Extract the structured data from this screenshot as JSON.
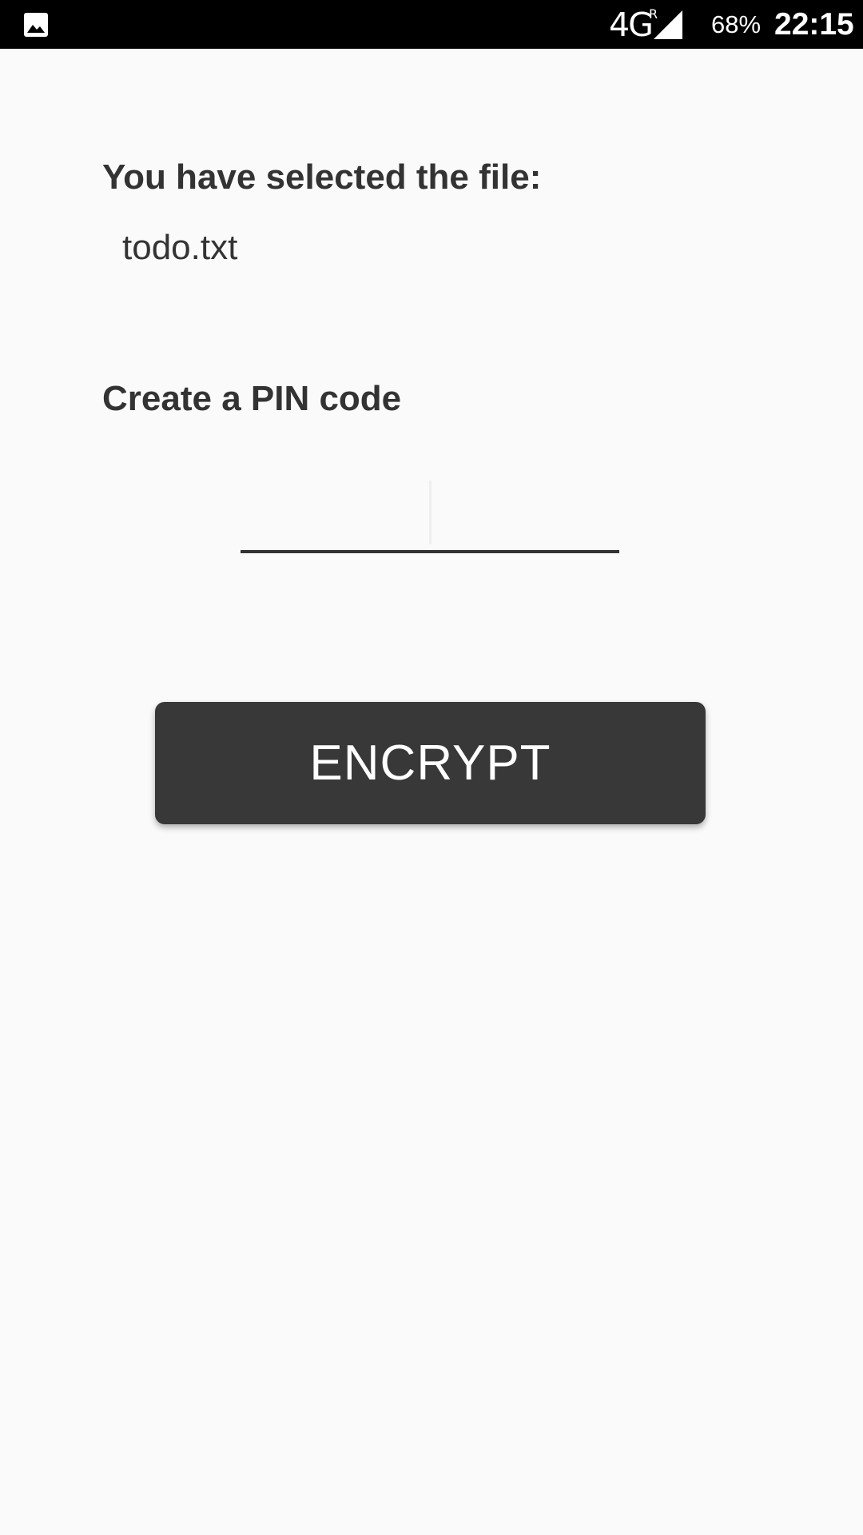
{
  "status_bar": {
    "network": "4G",
    "network_sup": "R",
    "battery": "68%",
    "time": "22:15",
    "icons": [
      "gallery-icon",
      "signal-icon"
    ]
  },
  "main": {
    "file_heading": "You have selected the file:",
    "file_name": "todo.txt",
    "pin_heading": "Create a PIN code",
    "pin_value": "",
    "encrypt_label": "ENCRYPT"
  },
  "colors": {
    "status_bar_bg": "#000000",
    "background": "#fafafa",
    "text": "#333333",
    "button_bg": "#383838",
    "button_text": "#ffffff"
  }
}
